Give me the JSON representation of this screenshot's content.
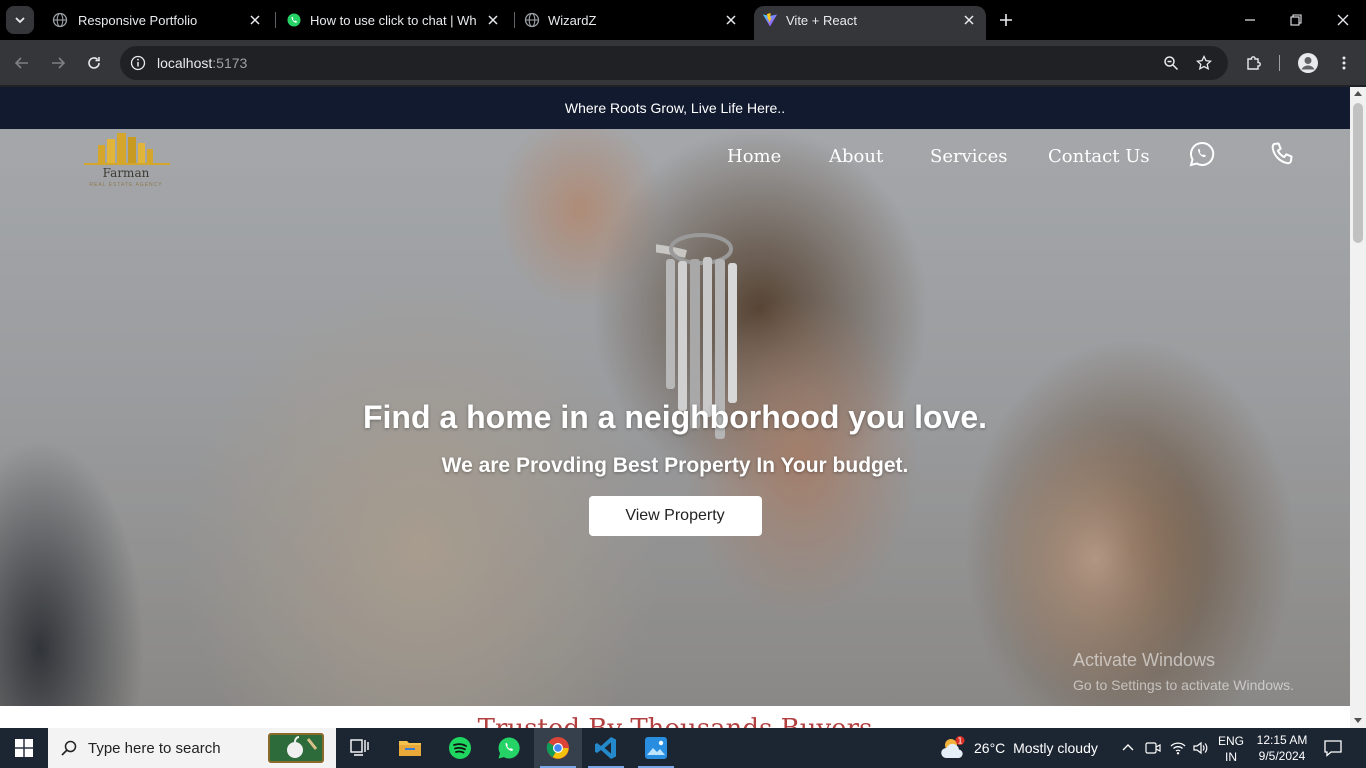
{
  "browser": {
    "tabs": [
      {
        "title": "Responsive Portfolio",
        "favicon": "globe-icon",
        "active": false
      },
      {
        "title": "How to use click to chat | WhatsApp",
        "favicon": "whatsapp-icon",
        "active": false
      },
      {
        "title": "WizardZ",
        "favicon": "globe-icon",
        "active": false
      },
      {
        "title": "Vite + React",
        "favicon": "vite-icon",
        "active": true
      }
    ],
    "address": {
      "host": "localhost",
      "port": ":5173"
    }
  },
  "page": {
    "topbar_text": "Where Roots Grow, Live Life Here..",
    "logo": {
      "name": "Farman",
      "tagline": "REAL ESTATE AGENCY"
    },
    "nav": {
      "items": [
        "Home",
        "About",
        "Services",
        "Contact Us"
      ]
    },
    "hero": {
      "title": "Find a home in a neighborhood you love.",
      "subtitle": "We are Provding Best Property In Your budget.",
      "cta": "View Property"
    },
    "next_section_heading": "Trusted By Thousands Buyers",
    "watermark": {
      "line1": "Activate Windows",
      "line2": "Go to Settings to activate Windows."
    }
  },
  "taskbar": {
    "search_placeholder": "Type here to search",
    "weather": {
      "temp": "26°C",
      "condition": "Mostly cloudy",
      "alert_count": "1"
    },
    "language": {
      "lang": "ENG",
      "region": "IN"
    },
    "clock": {
      "time": "12:15 AM",
      "date": "9/5/2024"
    }
  },
  "colors": {
    "topbar_bg": "#111a2e",
    "logo_gold": "#d4a72c",
    "heading_red": "#b34040",
    "taskbar_bg": "#1c2532"
  }
}
